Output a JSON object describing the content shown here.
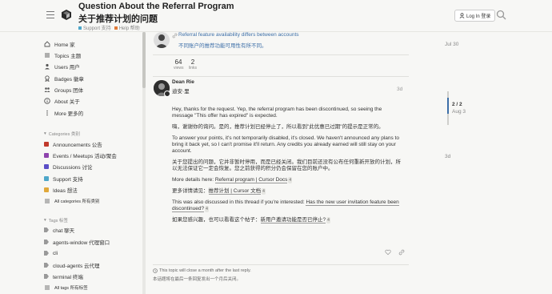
{
  "header": {
    "title_en": "Question About the Referral Program",
    "title_zh": "关于推荐计划的问题",
    "crumbs": [
      {
        "label": "Support 支持",
        "color": "#4ea7c9"
      },
      {
        "label": "Help 帮助",
        "color": "#e07b39"
      }
    ],
    "login_label": "Log In 登录"
  },
  "sidebar": {
    "nav": [
      {
        "label": "Home 家",
        "icon": "home-icon"
      },
      {
        "label": "Topics 主题",
        "icon": "topics-icon"
      },
      {
        "label": "Users 用户",
        "icon": "users-icon"
      },
      {
        "label": "Badges 徽章",
        "icon": "badge-icon"
      },
      {
        "label": "Groups 团体",
        "icon": "groups-icon"
      },
      {
        "label": "About 关于",
        "icon": "info-icon"
      },
      {
        "label": "More 更多的",
        "icon": "more-icon"
      }
    ],
    "categories_title": "Categories 类别",
    "categories": [
      {
        "label": "Announcements 公告",
        "color": "#c0392b"
      },
      {
        "label": "Events / Meetups 活动/聚会",
        "color": "#8e44ad"
      },
      {
        "label": "Discussions 讨论",
        "color": "#5b4fc7"
      },
      {
        "label": "Support 支持",
        "color": "#4ea7c9"
      },
      {
        "label": "Ideas 想法",
        "color": "#e0a83a"
      }
    ],
    "all_categories": "All categories 所有类别",
    "tags_title": "Tags 标签",
    "tags": [
      {
        "label": "chat 聊天"
      },
      {
        "label": "agents-window 代理窗口"
      },
      {
        "label": "cli"
      },
      {
        "label": "cloud-agents 云代理"
      },
      {
        "label": "terminal 终端"
      }
    ],
    "all_tags": "All tags 所有标签"
  },
  "linked_post": {
    "title_en": "Referral feature availability differs between accounts",
    "title_zh": "不同账户的推荐功能可用性有所不同。",
    "date": "Jul 30"
  },
  "stats": {
    "views_count": "64",
    "views_label": "views",
    "links_count": "2",
    "links_label": "links"
  },
  "post": {
    "author": "Dean Rie",
    "author_zh": "迪安·里",
    "date": "3d",
    "p1_en": "Hey, thanks for the request. Yep, the referral program has been discontinued, so seeing the message \"This offer has expired\" is expected.",
    "p1_zh": "嗨，谢谢你的询问。是的，推荐计划已经停止了，所以看到\"此优惠已过期\"的提示是正常的。",
    "p2_en": "To answer your points, it's not temporarily disabled, it's closed. We haven't announced any plans to bring it back yet, so I can't promise it'll return. Any credits you already earned will still stay on your account.",
    "p2_zh": "关于您提出的问题，它并非暂时停用，而是已经关闭。我们目前还没有公布任何重新开放的计划，所以无法保证它一定会恢复。您之前获得的积分仍会保留在您的账户中。",
    "more_details_prefix": "More details here: ",
    "more_details_link": "Referral program | Cursor Docs",
    "more_details_count": "4",
    "more_details_zh_prefix": "更多详情请见：",
    "more_details_zh_link": "推荐计划 | Cursor 文档",
    "more_details_zh_count": "4",
    "thread_prefix": "This was also discussed in this thread if you're interested: ",
    "thread_link": "Has the new user invitation feature been discontinued?",
    "thread_count": "4",
    "thread_zh_prefix": "如果您感兴趣，也可以看看这个帖子：",
    "thread_zh_link": "新用户邀请功能是否已停止?",
    "thread_zh_count": "4"
  },
  "footer": {
    "close_en": "This topic will close a month after the last reply.",
    "close_zh": "本话题将在最后一条回复发出一个月后关闭。"
  },
  "timeline": {
    "top_date": "Jul 30",
    "position": "2 / 2",
    "position_date": "Aug 3",
    "bottom_date": "3d"
  }
}
